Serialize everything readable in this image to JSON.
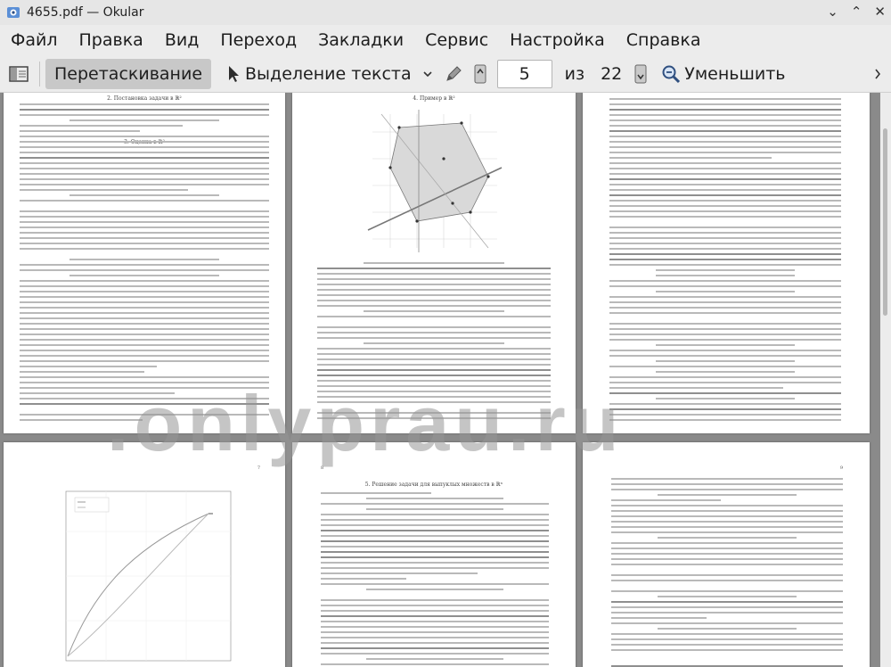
{
  "window": {
    "title": "4655.pdf — Okular",
    "controls": [
      "⌄",
      "⌃",
      "✕"
    ]
  },
  "menu": [
    "Файл",
    "Правка",
    "Вид",
    "Переход",
    "Закладки",
    "Сервис",
    "Настройка",
    "Справка"
  ],
  "toolbar": {
    "drag_label": "Перетаскивание",
    "select_label": "Выделение текста",
    "page_current": "5",
    "page_of": "из",
    "page_total": "22",
    "zoom_out_label": "Уменьшить"
  },
  "pages": {
    "p1_heading": "2. Постановка задачи в ℝ²",
    "p1_heading2": "3. Оценка в ℝ²",
    "p2_heading": "4. Пример в ℝ²",
    "p4_num": "7",
    "p5_heading": "5. Решение задачи для выпуклых множеств в ℝⁿ",
    "p5_num": "8",
    "p6_num": "9"
  },
  "watermark": ".onlyprau.ru",
  "colors": {
    "viewport": "#8a8a8a",
    "chrome": "#ececec"
  }
}
